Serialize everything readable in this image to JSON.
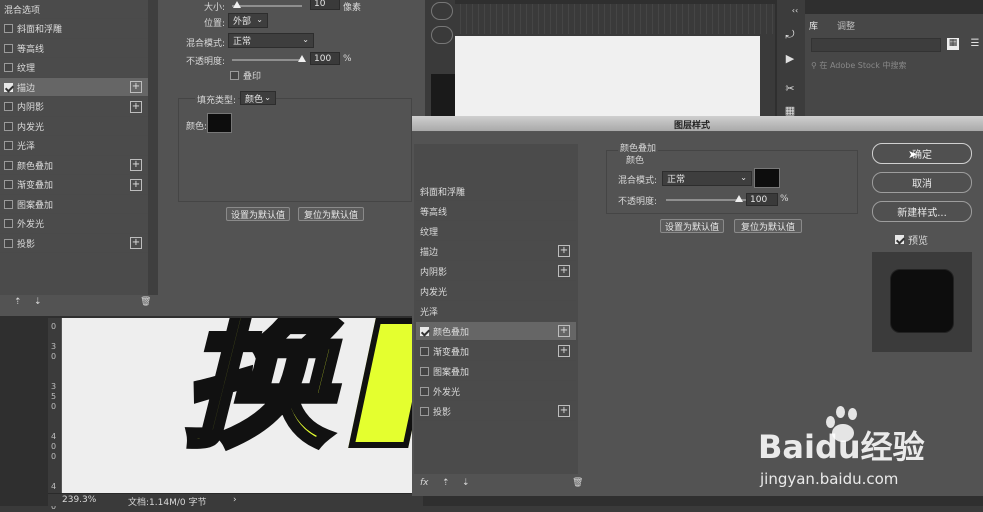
{
  "left_dialog": {
    "style_list": [
      {
        "label": "混合选项",
        "checkbox": false,
        "plus": false
      },
      {
        "label": "斜面和浮雕",
        "checkbox": true,
        "checked": false,
        "plus": false
      },
      {
        "label": "等高线",
        "checkbox": true,
        "checked": false,
        "plus": false
      },
      {
        "label": "纹理",
        "checkbox": true,
        "checked": false,
        "plus": false
      },
      {
        "label": "描边",
        "checkbox": true,
        "checked": true,
        "plus": true,
        "active": true
      },
      {
        "label": "内阴影",
        "checkbox": true,
        "checked": false,
        "plus": true
      },
      {
        "label": "内发光",
        "checkbox": true,
        "checked": false,
        "plus": false
      },
      {
        "label": "光泽",
        "checkbox": true,
        "checked": false,
        "plus": false
      },
      {
        "label": "颜色叠加",
        "checkbox": true,
        "checked": false,
        "plus": true
      },
      {
        "label": "渐变叠加",
        "checkbox": true,
        "checked": false,
        "plus": true
      },
      {
        "label": "图案叠加",
        "checkbox": true,
        "checked": false,
        "plus": false
      },
      {
        "label": "外发光",
        "checkbox": true,
        "checked": false,
        "plus": false
      },
      {
        "label": "投影",
        "checkbox": true,
        "checked": false,
        "plus": true
      }
    ],
    "size_label": "大小:",
    "size_value": "10",
    "size_unit": "像素",
    "position_label": "位置:",
    "position_value": "外部",
    "blend_label": "混合模式:",
    "blend_value": "正常",
    "opacity_label": "不透明度:",
    "opacity_value": "100",
    "opacity_unit": "%",
    "overprint_label": "叠印",
    "fill_type_label": "填充类型:",
    "fill_type_value": "颜色",
    "color_label": "颜色:",
    "set_default": "设置为默认值",
    "reset_default": "复位为默认值"
  },
  "canvas": {
    "zoom": "239.3%",
    "doc_info": "文档:1.14M/0 字节",
    "headline_text": "换",
    "ruler_marks": [
      "0",
      "3",
      "0",
      "3",
      "5",
      "0",
      "4",
      "0",
      "0",
      "4",
      "5",
      "0"
    ]
  },
  "right_panel": {
    "tab_library": "库",
    "tab_adjust": "调整",
    "search_placeholder": "在 Adobe Stock 中搜索"
  },
  "main_dialog": {
    "title": "图层样式",
    "style_list": [
      {
        "label": "斜面和浮雕",
        "checkbox": false,
        "checked": false,
        "plus": false
      },
      {
        "label": "等高线",
        "checkbox": false,
        "checked": false,
        "plus": false
      },
      {
        "label": "纹理",
        "checkbox": false,
        "checked": false,
        "plus": false
      },
      {
        "label": "描边",
        "checkbox": false,
        "checked": false,
        "plus": true
      },
      {
        "label": "内阴影",
        "checkbox": false,
        "checked": false,
        "plus": true
      },
      {
        "label": "内发光",
        "checkbox": false,
        "checked": false,
        "plus": false
      },
      {
        "label": "光泽",
        "checkbox": false,
        "checked": false,
        "plus": false
      },
      {
        "label": "颜色叠加",
        "checkbox": true,
        "checked": true,
        "plus": true,
        "active": true
      },
      {
        "label": "渐变叠加",
        "checkbox": true,
        "checked": false,
        "plus": true
      },
      {
        "label": "图案叠加",
        "checkbox": true,
        "checked": false,
        "plus": false
      },
      {
        "label": "外发光",
        "checkbox": true,
        "checked": false,
        "plus": false
      },
      {
        "label": "投影",
        "checkbox": true,
        "checked": false,
        "plus": true
      }
    ],
    "section_title": "颜色叠加",
    "group_title": "颜色",
    "blend_label": "混合模式:",
    "blend_value": "正常",
    "opacity_label": "不透明度:",
    "opacity_value": "100",
    "opacity_unit": "%",
    "set_default": "设置为默认值",
    "reset_default": "复位为默认值",
    "ok": "确定",
    "cancel": "取消",
    "new_style": "新建样式...",
    "preview_label": "预览"
  },
  "watermark": {
    "brand": "Baidu经验",
    "url": "jingyan.baidu.com"
  },
  "colors": {
    "accent_yellow": "#e4ff2f",
    "swatch": "#0d0d0d",
    "panel": "#535353"
  }
}
